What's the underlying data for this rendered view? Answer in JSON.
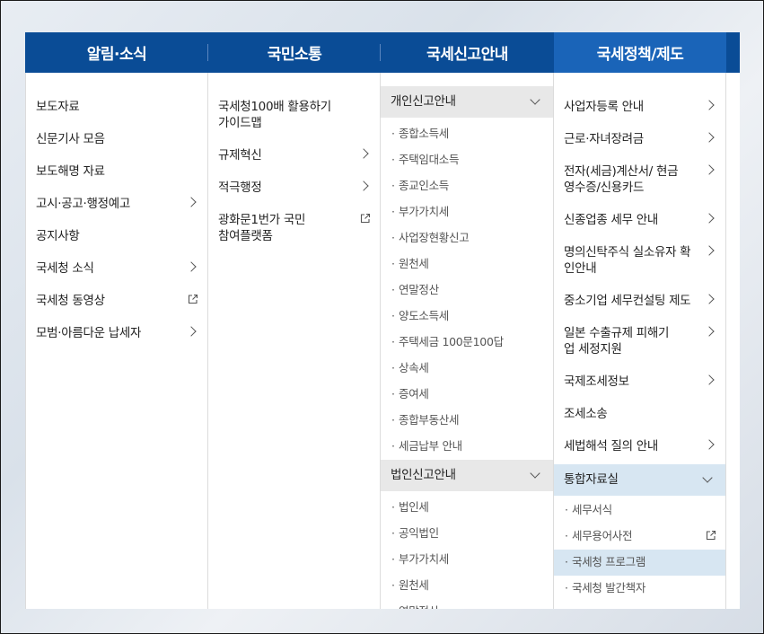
{
  "top_tabs": [
    {
      "label": "알림·소식"
    },
    {
      "label": "국민소통"
    },
    {
      "label": "국세신고안내"
    },
    {
      "label": "국세정책/제도"
    }
  ],
  "col1": {
    "items": [
      {
        "label": "보도자료"
      },
      {
        "label": "신문기사 모음"
      },
      {
        "label": "보도해명 자료"
      },
      {
        "label": "고시·공고·행정예고"
      },
      {
        "label": "공지사항"
      },
      {
        "label": "국세청 소식"
      },
      {
        "label": "국세청 동영상"
      },
      {
        "label": "모범·아름다운 납세자"
      }
    ]
  },
  "col2": {
    "items": [
      {
        "label": "국세청100배 활용하기 가이드맵"
      },
      {
        "label": "규제혁신"
      },
      {
        "label": "적극행정"
      },
      {
        "label": "광화문1번가 국민참여플랫폼"
      }
    ]
  },
  "col3": {
    "group1": {
      "label": "개인신고안내",
      "items": [
        "종합소득세",
        "주택임대소득",
        "종교인소득",
        "부가가치세",
        "사업장현황신고",
        "원천세",
        "연말정산",
        "양도소득세",
        "주택세금 100문100답",
        "상속세",
        "증여세",
        "종합부동산세",
        "세금납부 안내"
      ]
    },
    "group2": {
      "label": "법인신고안내",
      "items": [
        "법인세",
        "공익법인",
        "부가가치세",
        "원천세",
        "연말정산"
      ]
    }
  },
  "col4": {
    "items": [
      {
        "label": "사업자등록 안내"
      },
      {
        "label": "근로·자녀장려금"
      },
      {
        "label": "전자(세금)계산서/ 현금영수증/신용카드"
      },
      {
        "label": "신종업종 세무 안내"
      },
      {
        "label": "명의신탁주식 실소유자 확인안내"
      },
      {
        "label": "중소기업 세무컨설팅 제도"
      },
      {
        "label": "일본 수출규제 피해기업 세정지원"
      },
      {
        "label": "국제조세정보"
      },
      {
        "label": "조세소송"
      },
      {
        "label": "세법해석 질의 안내"
      }
    ],
    "group": {
      "label": "통합자료실",
      "items": [
        "세무서식",
        "세무용어사전",
        "국세청 프로그램",
        "국세청 발간책자"
      ]
    }
  },
  "colors": {
    "topbar": "#0a4c96",
    "active_tab": "#1a64b8",
    "selected": "#d7e6f2"
  }
}
